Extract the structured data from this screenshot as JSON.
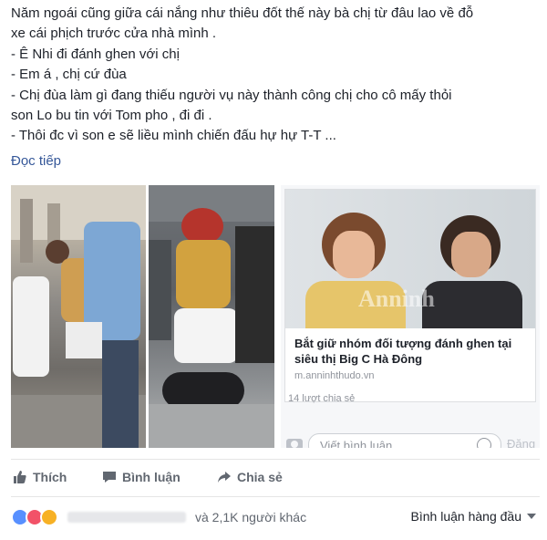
{
  "post": {
    "lines": [
      "Năm ngoái cũng giữa cái nắng như thiêu đốt thế này bà chị từ đâu lao về đỗ",
      "xe cái phịch trước cửa nhà mình .",
      "- Ê Nhi đi đánh ghen với chị",
      "- Em á , chị cứ đùa",
      "- Chị đùa làm gì đang thiếu người vụ này thành công chị cho cô mấy thỏi",
      "son Lo bu tin với Tom pho , đi đi .",
      "- Thôi đc vì son e sẽ liều mình chiến đấu hự hự T-T ..."
    ],
    "more_link": "Đọc tiếp"
  },
  "link_card": {
    "watermark": "Anninh",
    "title": "Bắt giữ nhóm đối tượng đánh ghen tại siêu thị Big C Hà Đông",
    "domain": "m.anninhthudo.vn",
    "shares": "14 lượt chia sẻ",
    "comment_placeholder": "Viết bình luận...",
    "post_button": "Đăng"
  },
  "actions": {
    "like": "Thích",
    "comment": "Bình luận",
    "share": "Chia sẻ"
  },
  "reactions": {
    "types": [
      "like-icon",
      "love-icon",
      "wow-icon"
    ],
    "others_text": "và 2,1K người khác"
  },
  "sort": {
    "label": "Bình luận hàng đầu"
  },
  "colors": {
    "link": "#365899",
    "secondary_text": "#616770",
    "like": "#5890ff",
    "love": "#f25268",
    "wow": "#f7b125"
  }
}
